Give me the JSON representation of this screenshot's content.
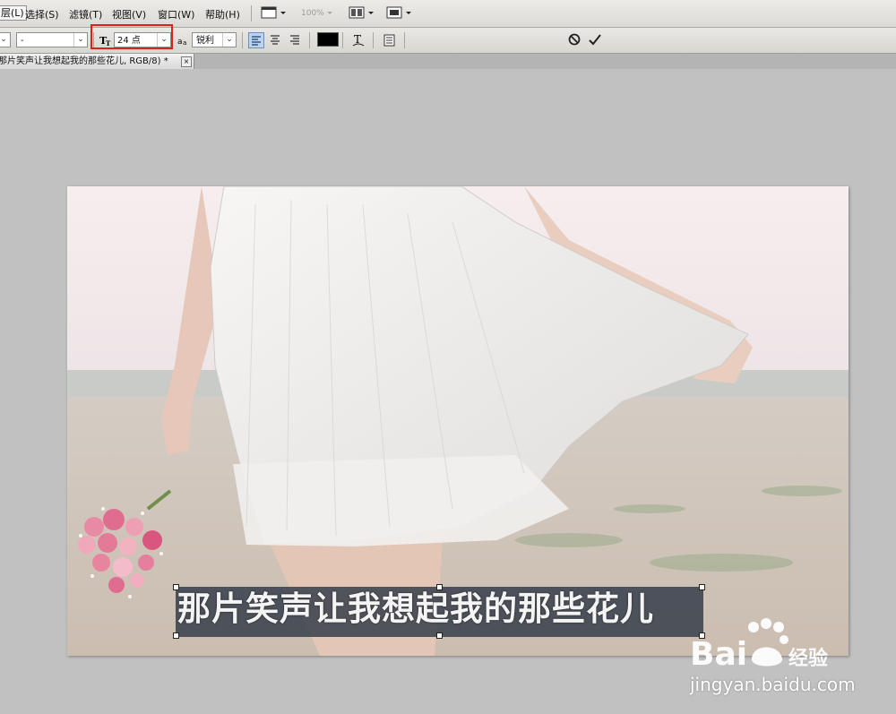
{
  "menubar": {
    "items": [
      "层(L)",
      "选择(S)",
      "滤镜(T)",
      "视图(V)",
      "窗口(W)",
      "帮助(H)"
    ],
    "zoom": "100%"
  },
  "options": {
    "font_style_value": "-",
    "font_size_value": "24 点",
    "antialias_value": "锐利",
    "text_color": "#000000"
  },
  "tab": {
    "title": "那片笑声让我想起我的那些花儿, RGB/8) *",
    "close": "×"
  },
  "canvas": {
    "caption": "那片笑声让我想起我的那些花儿"
  },
  "watermark": {
    "brand": "Bai",
    "brand_suffix": "du",
    "label": "经验",
    "url": "jingyan.baidu.com"
  },
  "colors": {
    "highlight": "#e0201a",
    "active_align": "#bcd3ee"
  }
}
